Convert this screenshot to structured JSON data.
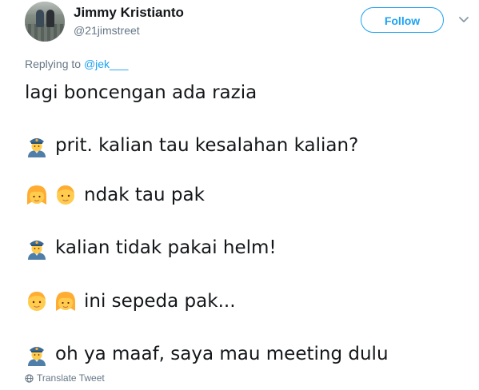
{
  "author": {
    "display_name": "Jimmy Kristianto",
    "screen_name": "@21jimstreet"
  },
  "header": {
    "follow_label": "Follow",
    "menu_icon": "chevron-down-icon"
  },
  "reply": {
    "prefix": "Replying to ",
    "mention": "@jek___"
  },
  "tweet": {
    "lines": [
      {
        "icons": [],
        "text": "lagi boncengan ada razia"
      },
      {
        "icons": [
          "police-officer-icon"
        ],
        "text": "prit. kalian tau kesalahan kalian?"
      },
      {
        "icons": [
          "girl-face-icon",
          "child-face-icon"
        ],
        "text": "ndak tau pak"
      },
      {
        "icons": [
          "police-officer-icon"
        ],
        "text": "kalian tidak pakai helm!"
      },
      {
        "icons": [
          "child-face-icon",
          "girl-face-icon"
        ],
        "text": "ini sepeda pak..."
      },
      {
        "icons": [
          "police-officer-icon"
        ],
        "text": "oh ya maaf, saya mau meeting dulu"
      }
    ]
  },
  "footer": {
    "translate_label": "Translate Tweet",
    "translate_icon": "globe-icon"
  },
  "colors": {
    "accent": "#1da1f2",
    "muted": "#657786",
    "text": "#14171a"
  }
}
